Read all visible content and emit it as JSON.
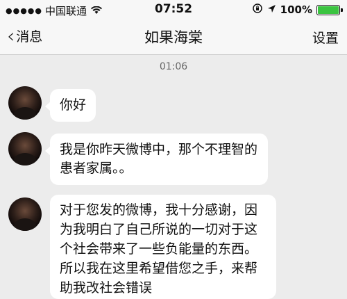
{
  "status_bar": {
    "carrier": "中国联通",
    "time": "07:52",
    "battery": "100%",
    "battery_level": 1.0,
    "icons": [
      "signal-dots-icon",
      "wifi-icon",
      "orientation-lock-icon",
      "location-arrow-icon",
      "battery-icon"
    ]
  },
  "nav": {
    "back_label": "消息",
    "title": "如果海棠",
    "settings_label": "设置"
  },
  "chat": {
    "timestamp": "01:06",
    "messages": [
      {
        "text": "你好"
      },
      {
        "text": "我是你昨天微博中，那个不理智的患者家属。。"
      },
      {
        "text": "对于您发的微博，我十分感谢，因为我明白了自己所说的一切对于这个社会带来了一些负能量的东西。所以我在这里希望借您之手，来帮助我改社会错误"
      }
    ]
  },
  "colors": {
    "background": "#ececec",
    "bar": "#f7f7f7",
    "bubble": "#ffffff",
    "battery": "#3ac440"
  }
}
